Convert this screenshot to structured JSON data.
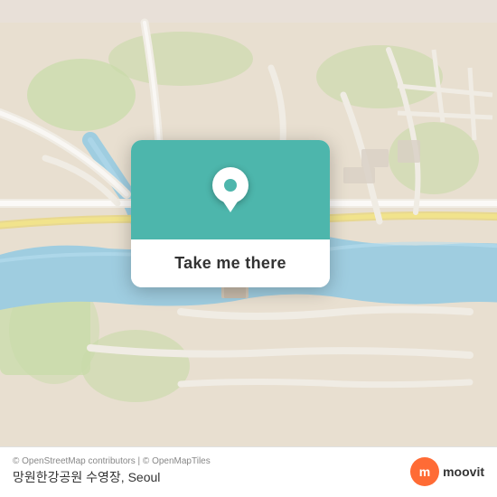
{
  "map": {
    "background_color": "#e8e0d8",
    "river_color": "#a8d4e8",
    "green_color": "#c8dbb0",
    "road_color": "#ffffff",
    "card_bg_color": "#4db6ac"
  },
  "card": {
    "button_label": "Take me there",
    "pin_color": "#4db6ac"
  },
  "bottom_bar": {
    "attribution": "© OpenStreetMap contributors | © OpenMapTiles",
    "location_name": "망원한강공원 수영장, Seoul"
  },
  "moovit": {
    "label": "moovit",
    "icon": "m"
  }
}
